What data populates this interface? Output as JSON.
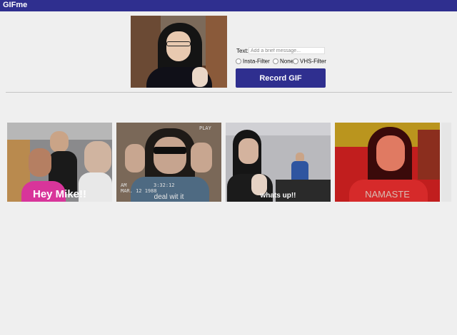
{
  "app": {
    "title": "GIFme",
    "accent_color": "#2f2f8f"
  },
  "composer": {
    "text_label": "Text:",
    "text_placeholder": "Add a brief message...",
    "filters": [
      {
        "label": "Insta-Filter",
        "selected": false
      },
      {
        "label": "None",
        "selected": false
      },
      {
        "label": "VHS-Filter",
        "selected": false
      }
    ],
    "record_label": "Record GIF"
  },
  "gallery": [
    {
      "caption": "Hey Mike!!"
    },
    {
      "caption": "deal wit it",
      "overlay": {
        "play": "PLAY",
        "time_am": "AM",
        "time": "3:32:12",
        "date": "MAR. 12 1988"
      }
    },
    {
      "caption": "whats up!!"
    },
    {
      "caption": "NAMASTE"
    }
  ]
}
